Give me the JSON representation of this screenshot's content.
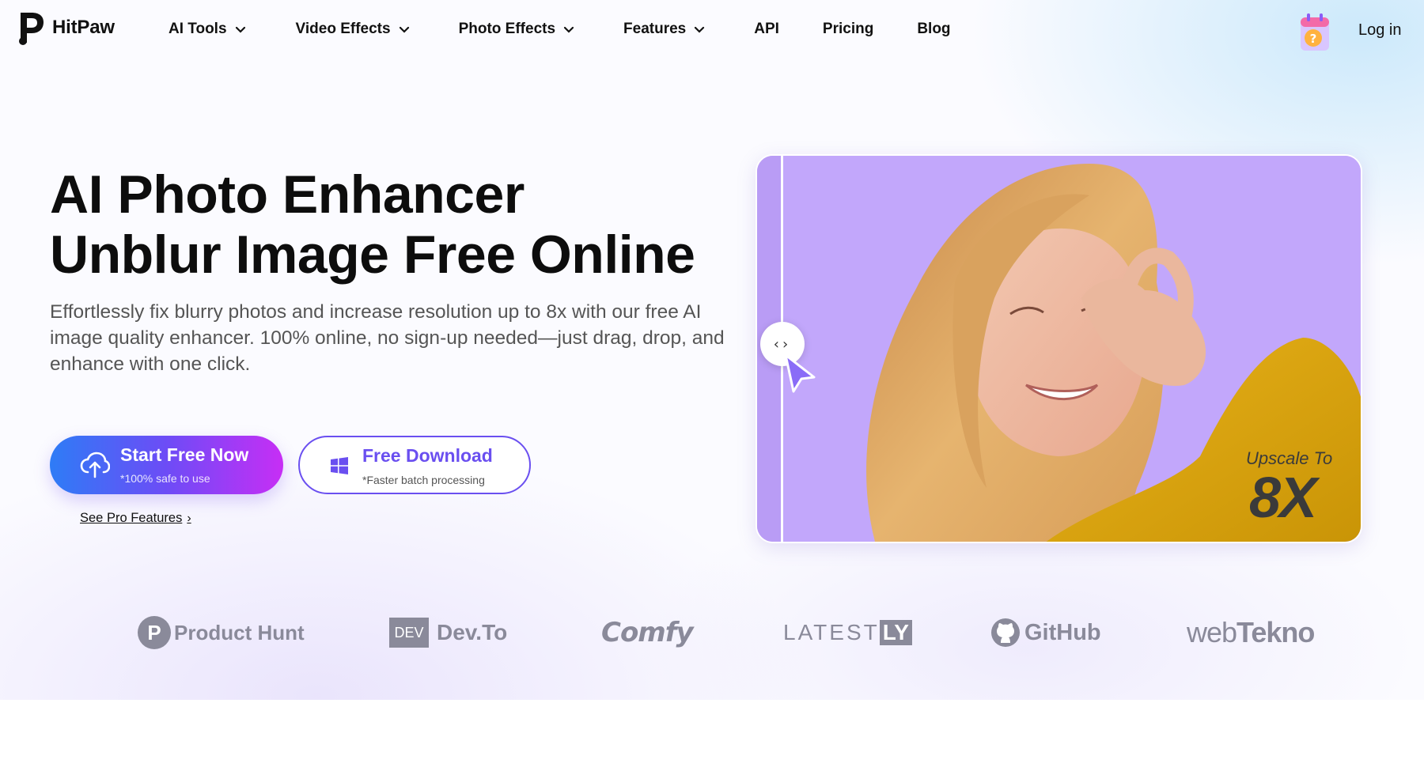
{
  "brand": {
    "name": "HitPaw"
  },
  "nav": {
    "items": [
      {
        "label": "AI Tools",
        "dropdown": true
      },
      {
        "label": "Video Effects",
        "dropdown": true
      },
      {
        "label": "Photo Effects",
        "dropdown": true
      },
      {
        "label": "Features",
        "dropdown": true
      },
      {
        "label": "API",
        "dropdown": false
      },
      {
        "label": "Pricing",
        "dropdown": false
      },
      {
        "label": "Blog",
        "dropdown": false
      }
    ],
    "login": "Log in"
  },
  "hero": {
    "title_line1": "AI Photo Enhancer",
    "title_line2": "Unblur Image Free Online",
    "description": "Effortlessly fix blurry photos and increase resolution up to 8x with our free AI image quality enhancer. 100% online, no sign-up needed—just drag, drop, and enhance with one click.",
    "start_button": {
      "label": "Start Free Now",
      "sub": "*100% safe to use"
    },
    "download_button": {
      "label": "Free Download",
      "sub": "*Faster batch processing"
    },
    "pro_link": "See Pro Features"
  },
  "preview": {
    "upscale_label": "Upscale To",
    "upscale_value": "8X"
  },
  "partners": {
    "product_hunt": "Product Hunt",
    "dev_badge": "DEV",
    "dev_to": "Dev.To",
    "comfy": "Comfy",
    "latest": "LATEST",
    "latest_badge": "LY",
    "github": "GitHub",
    "webtekno_a": "web",
    "webtekno_b": "Tekno"
  },
  "colors": {
    "accent_purple": "#6a4ff0",
    "gradient_start": "#2e7cf6",
    "gradient_end": "#c72ef5",
    "panel_bg": "#c2a7fb",
    "partner_gray": "#8a8a9a"
  },
  "icons": {
    "nav_chevron": "chevron-down-icon",
    "upload": "cloud-upload-icon",
    "windows": "windows-icon",
    "promo": "gift-calendar-icon",
    "compare_handle": "compare-arrows-icon",
    "cursor": "cursor-arrow-icon"
  }
}
